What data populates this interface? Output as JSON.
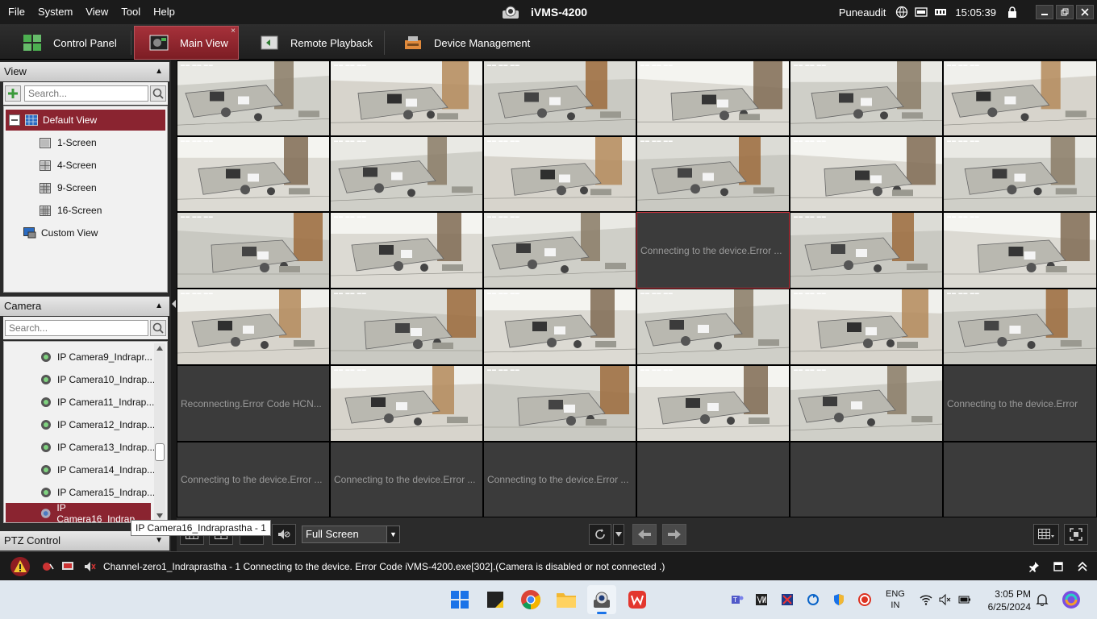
{
  "titlebar": {
    "menu": [
      "File",
      "System",
      "View",
      "Tool",
      "Help"
    ],
    "app_title": "iVMS-4200",
    "user": "Puneaudit",
    "time": "15:05:39"
  },
  "tabs": [
    {
      "label": "Control Panel"
    },
    {
      "label": "Main View"
    },
    {
      "label": "Remote Playback"
    },
    {
      "label": "Device Management"
    }
  ],
  "view_panel": {
    "title": "View",
    "search_placeholder": "Search...",
    "default_view": "Default View",
    "screens": [
      "1-Screen",
      "4-Screen",
      "9-Screen",
      "16-Screen"
    ],
    "custom_view": "Custom View"
  },
  "camera_panel": {
    "title": "Camera",
    "search_placeholder": "Search...",
    "cameras": [
      "IP Camera9_Indrapr...",
      "IP Camera10_Indrap...",
      "IP Camera11_Indrap...",
      "IP Camera12_Indrap...",
      "IP Camera13_Indrap...",
      "IP Camera14_Indrap...",
      "IP Camera15_Indrap...",
      "IP Camera16_Indrap..."
    ]
  },
  "ptz_panel": {
    "title": "PTZ Control"
  },
  "grid_messages": {
    "connecting": "Connecting to the device.Error ...",
    "connecting_short": "Connecting to the device.Error",
    "reconnecting": "Reconnecting.Error Code HCN..."
  },
  "toolbar": {
    "fullscreen_label": "Full Screen"
  },
  "tooltip": "IP Camera16_Indraprastha - 1",
  "status": {
    "message": "Channel-zero1_Indraprastha - 1 Connecting to the device. Error Code iVMS-4200.exe[302].(Camera is disabled or not connected .)"
  },
  "taskbar": {
    "lang_top": "ENG",
    "lang_bottom": "IN",
    "clock_time": "3:05 PM",
    "clock_date": "6/25/2024"
  }
}
